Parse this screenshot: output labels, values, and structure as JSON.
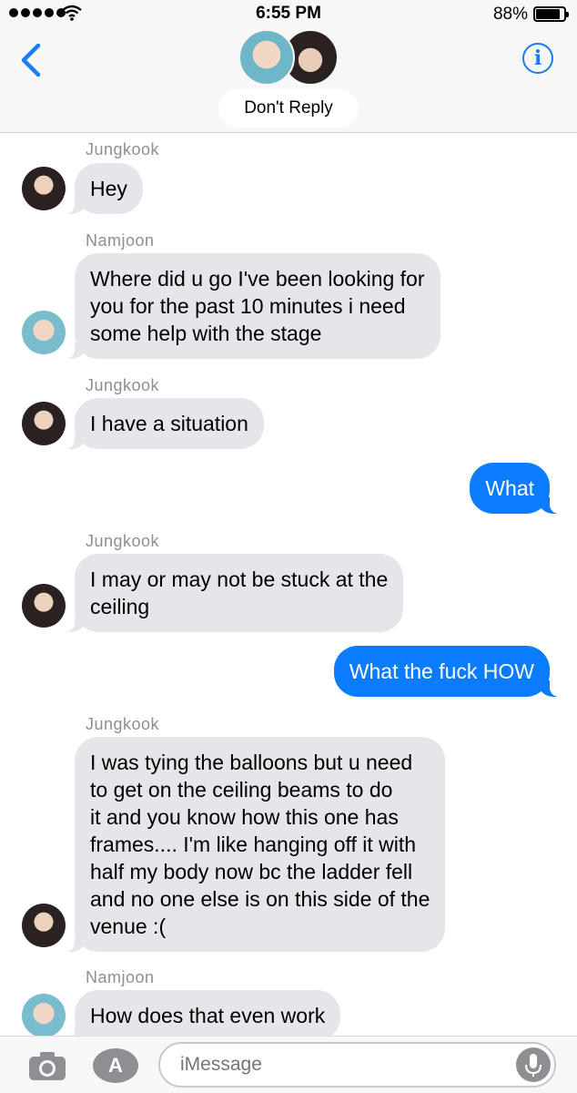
{
  "status_bar": {
    "time": "6:55 PM",
    "battery_percent": "88%",
    "battery_level": 0.88,
    "signal_dots": 5
  },
  "header": {
    "group_name": "Don't Reply",
    "back_icon": "chevron-left-icon",
    "info_icon": "info-icon",
    "info_glyph": "i"
  },
  "messages": [
    {
      "sender": "Jungkook",
      "text": "Hey",
      "direction": "incoming"
    },
    {
      "sender": "Namjoon",
      "text": "Where did u go I've been looking for\nyou for the past 10 minutes i need\nsome help with the stage",
      "direction": "incoming"
    },
    {
      "sender": "Jungkook",
      "text": "I have a situation",
      "direction": "incoming"
    },
    {
      "text": "What",
      "direction": "outgoing"
    },
    {
      "sender": "Jungkook",
      "text": "I may or may not be stuck at the\nceiling",
      "direction": "incoming"
    },
    {
      "text": "What the fuck HOW",
      "direction": "outgoing"
    },
    {
      "sender": "Jungkook",
      "text": "I was tying the balloons but u need\nto get on the ceiling beams to do\nit and you know how this one has\nframes.... I'm like hanging off it with\nhalf my body now bc the ladder fell\nand no one else is on this side of the\nvenue :(",
      "direction": "incoming"
    },
    {
      "sender": "Namjoon",
      "text": "How does that even work",
      "direction": "incoming"
    }
  ],
  "input_bar": {
    "placeholder": "iMessage",
    "camera_icon": "camera-icon",
    "apps_icon": "app-store-icon",
    "apps_glyph": "A",
    "mic_icon": "microphone-icon"
  },
  "colors": {
    "accent": "#1a7cf7",
    "outgoing_bubble": "#0a7cff",
    "incoming_bubble": "#e5e5ea",
    "sender_label": "#8e8e93"
  }
}
